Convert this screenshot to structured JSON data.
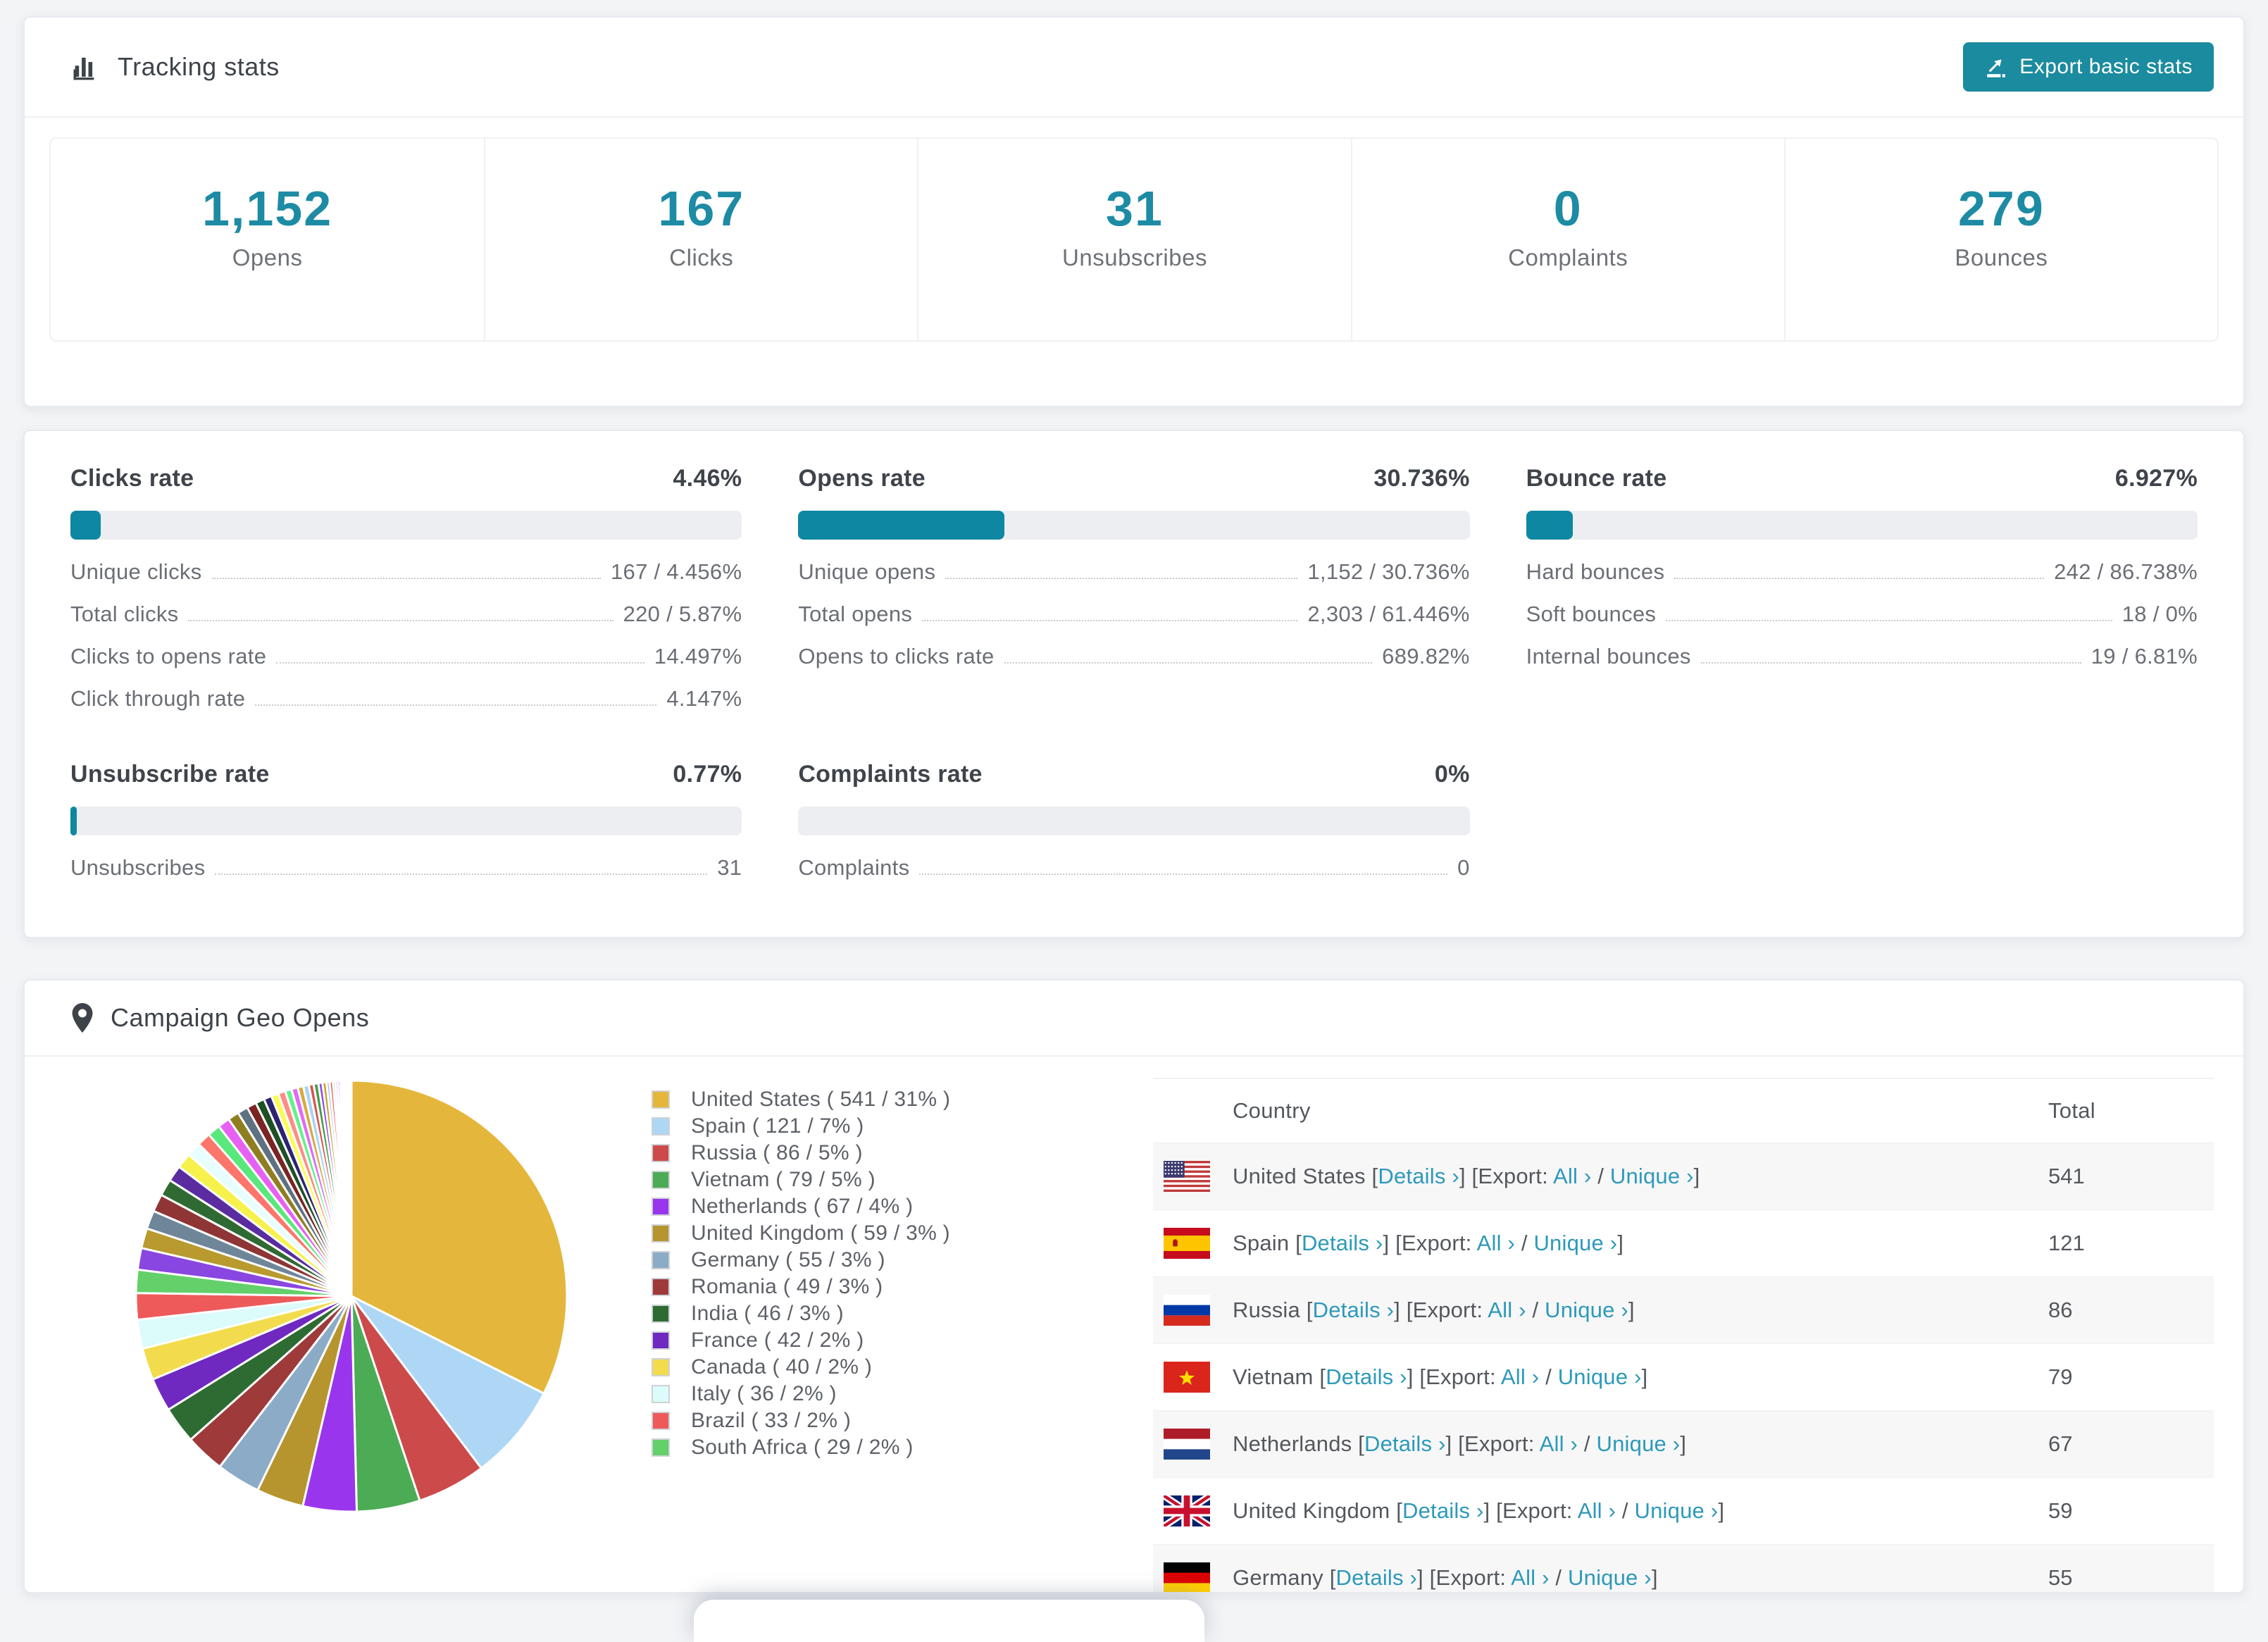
{
  "page": {
    "background": "#f3f4f6",
    "accent": "#1d8ba4",
    "bar_fill": "#0e87a2",
    "bar_track": "#eceef2",
    "link_color": "#2d99ba"
  },
  "tracking": {
    "title": "Tracking stats",
    "export_button": "Export basic stats",
    "stats": [
      {
        "value": "1,152",
        "label": "Opens"
      },
      {
        "value": "167",
        "label": "Clicks"
      },
      {
        "value": "31",
        "label": "Unsubscribes"
      },
      {
        "value": "0",
        "label": "Complaints"
      },
      {
        "value": "279",
        "label": "Bounces"
      }
    ]
  },
  "rates": [
    {
      "title": "Clicks rate",
      "value": "4.46%",
      "percent": 4.46,
      "rows": [
        {
          "label": "Unique clicks",
          "value": "167 / 4.456%"
        },
        {
          "label": "Total clicks",
          "value": "220 / 5.87%"
        },
        {
          "label": "Clicks to opens rate",
          "value": "14.497%"
        },
        {
          "label": "Click through rate",
          "value": "4.147%"
        }
      ]
    },
    {
      "title": "Opens rate",
      "value": "30.736%",
      "percent": 30.736,
      "rows": [
        {
          "label": "Unique opens",
          "value": "1,152 / 30.736%"
        },
        {
          "label": "Total opens",
          "value": "2,303 / 61.446%"
        },
        {
          "label": "Opens to clicks rate",
          "value": "689.82%"
        }
      ]
    },
    {
      "title": "Bounce rate",
      "value": "6.927%",
      "percent": 6.927,
      "rows": [
        {
          "label": "Hard bounces",
          "value": "242 / 86.738%"
        },
        {
          "label": "Soft bounces",
          "value": "18 / 0%"
        },
        {
          "label": "Internal bounces",
          "value": "19 / 6.81%"
        }
      ]
    },
    {
      "title": "Unsubscribe rate",
      "value": "0.77%",
      "percent": 0.77,
      "rows": [
        {
          "label": "Unsubscribes",
          "value": "31"
        }
      ]
    },
    {
      "title": "Complaints rate",
      "value": "0%",
      "percent": 0,
      "rows": [
        {
          "label": "Complaints",
          "value": "0"
        }
      ]
    }
  ],
  "geo": {
    "title": "Campaign Geo Opens",
    "chart_data": {
      "type": "pie",
      "title": "Campaign Geo Opens",
      "start_angle": "top",
      "direction": "clockwise",
      "slices": [
        {
          "label": "United States",
          "value": 541,
          "pct": 31,
          "color": "#e5b63c",
          "display": "United States ( 541 / 31% )"
        },
        {
          "label": "Spain",
          "value": 121,
          "pct": 7,
          "color": "#aed7f5",
          "display": "Spain ( 121 / 7% )"
        },
        {
          "label": "Russia",
          "value": 86,
          "pct": 5,
          "color": "#cc4a4a",
          "display": "Russia ( 86 / 5% )"
        },
        {
          "label": "Vietnam",
          "value": 79,
          "pct": 5,
          "color": "#4cab55",
          "display": "Vietnam ( 79 / 5% )"
        },
        {
          "label": "Netherlands",
          "value": 67,
          "pct": 4,
          "color": "#9a35ee",
          "display": "Netherlands ( 67 / 4% )"
        },
        {
          "label": "United Kingdom",
          "value": 59,
          "pct": 3,
          "color": "#b6952f",
          "display": "United Kingdom ( 59 / 3% )"
        },
        {
          "label": "Germany",
          "value": 55,
          "pct": 3,
          "color": "#8cabc6",
          "display": "Germany ( 55 / 3% )"
        },
        {
          "label": "Romania",
          "value": 49,
          "pct": 3,
          "color": "#9e3a3a",
          "display": "Romania ( 49 / 3% )"
        },
        {
          "label": "India",
          "value": 46,
          "pct": 3,
          "color": "#2e6b33",
          "display": "India ( 46 / 3% )"
        },
        {
          "label": "France",
          "value": 42,
          "pct": 2,
          "color": "#6f28c0",
          "display": "France ( 42 / 2% )"
        },
        {
          "label": "Canada",
          "value": 40,
          "pct": 2,
          "color": "#f2dc4e",
          "display": "Canada ( 40 / 2% )"
        },
        {
          "label": "Italy",
          "value": 36,
          "pct": 2,
          "color": "#dcfbfb",
          "display": "Italy ( 36 / 2% )"
        },
        {
          "label": "Brazil",
          "value": 33,
          "pct": 2,
          "color": "#ee5a5a",
          "display": "Brazil ( 33 / 2% )"
        },
        {
          "label": "South Africa",
          "value": 29,
          "pct": 2,
          "color": "#63d06a",
          "display": "South Africa ( 29 / 2% )"
        }
      ],
      "other_slices_values": [
        27,
        25,
        23,
        22,
        21,
        20,
        19,
        18,
        17,
        16,
        15,
        14,
        13,
        12,
        11,
        10,
        9,
        9,
        8,
        8,
        7,
        7,
        6,
        6,
        5,
        5,
        4,
        4,
        3,
        3,
        3,
        2,
        2,
        2,
        2,
        1,
        1,
        1,
        1,
        1,
        1
      ],
      "other_slices_palette": [
        "#8a46e0",
        "#b89a2e",
        "#6f8699",
        "#8f3535",
        "#2f6a33",
        "#5a2ca0",
        "#f7f14b",
        "#e8fdfe",
        "#fd766b",
        "#59e87b",
        "#e661f2",
        "#8f7e20",
        "#5d7181",
        "#7a2424",
        "#1d5024",
        "#2c2470",
        "#fbfb57",
        "#fd8d85",
        "#66f08c",
        "#e06cf5",
        "#d8a93c",
        "#a6d4f5",
        "#d9534f",
        "#43a047",
        "#8e44e8",
        "#caa22a",
        "#9fc8ea",
        "#ef5350",
        "#5cb85c",
        "#cf6ef0"
      ]
    },
    "table": {
      "headers": {
        "country": "Country",
        "total": "Total"
      },
      "link_labels": {
        "open_bracket": "[",
        "details": "Details ›",
        "close_bracket": "]",
        "export_prefix": "[Export:",
        "all": "All ›",
        "slash": "/",
        "unique": "Unique ›"
      },
      "rows": [
        {
          "country": "United States",
          "flag": "us",
          "total": "541"
        },
        {
          "country": "Spain",
          "flag": "es",
          "total": "121"
        },
        {
          "country": "Russia",
          "flag": "ru",
          "total": "86"
        },
        {
          "country": "Vietnam",
          "flag": "vn",
          "total": "79"
        },
        {
          "country": "Netherlands",
          "flag": "nl",
          "total": "67"
        },
        {
          "country": "United Kingdom",
          "flag": "gb",
          "total": "59"
        },
        {
          "country": "Germany",
          "flag": "de",
          "total": "55"
        }
      ]
    }
  }
}
